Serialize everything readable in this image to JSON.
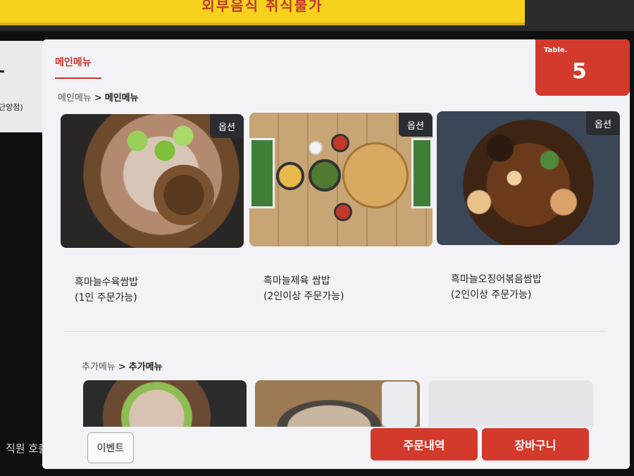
{
  "sign": {
    "text": "외부음식 취식불가"
  },
  "left_panel": {
    "store_suffix": "단양점)",
    "staff_call": "직원 호출"
  },
  "header": {
    "main_tab": "메인메뉴"
  },
  "table_badge": {
    "label": "Table.",
    "number": "5"
  },
  "main_section": {
    "breadcrumb_parent": "메인메뉴",
    "breadcrumb_sep": ">",
    "breadcrumb_current": "메인메뉴",
    "items": [
      {
        "option_label": "옵션",
        "name": "흑마늘수육쌈밥\n(1인 주문가능)"
      },
      {
        "option_label": "옵션",
        "name": "흑마늘제육 쌈밥\n(2인이상 주문가능)"
      },
      {
        "option_label": "옵션",
        "name": "흑마늘오징어볶음쌈밥\n(2인이상 주문가능)"
      }
    ]
  },
  "extra_section": {
    "breadcrumb_parent": "추가메뉴",
    "breadcrumb_sep": ">",
    "breadcrumb_current": "추가메뉴"
  },
  "bottom": {
    "event_label": "이벤트",
    "order_history_label": "주문내역",
    "cart_label": "장바구니"
  },
  "colors": {
    "accent": "#d33a2c",
    "option_badge": "#2b2d33",
    "screen_bg": "#f3f3f7"
  }
}
